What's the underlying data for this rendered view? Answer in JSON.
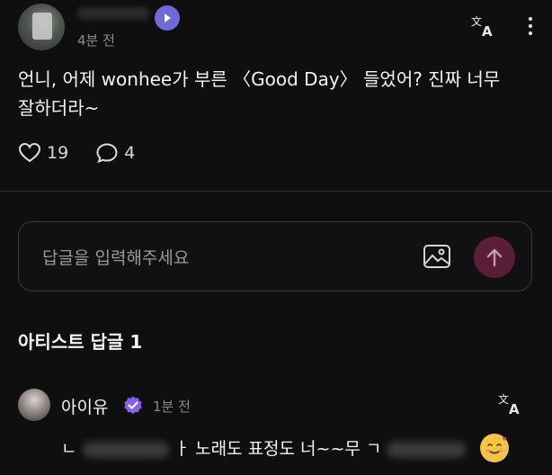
{
  "post": {
    "time": "4분 전",
    "body": "언니, 어제 wonhee가 부른 〈Good Day〉 들었어? 진짜 너무\n잘하더라~",
    "likes": "19",
    "comments": "4"
  },
  "reply_box": {
    "placeholder": "답글을 입력해주세요"
  },
  "artist_section": {
    "title": "아티스트 답글 1",
    "reply": {
      "name": "아이유",
      "time": "1분 전",
      "text_visible": "ㄴ",
      "text_visible_2": "ㅏ 노래도 표정도 너~~무 ",
      "text_visible_3": "ㄱ"
    }
  },
  "colors": {
    "background": "#0f0f10",
    "accent_send": "#5a1e36",
    "verified": "#8a5cf0",
    "play_badge": "#6e6ad8"
  },
  "icons": {
    "post_translate": "translate-icon",
    "more": "more-vertical-icon",
    "like": "heart-icon",
    "comment": "comment-bubble-icon",
    "image": "image-icon",
    "send": "arrow-up-icon",
    "verified": "verified-badge-icon",
    "reply_translate": "translate-icon"
  }
}
